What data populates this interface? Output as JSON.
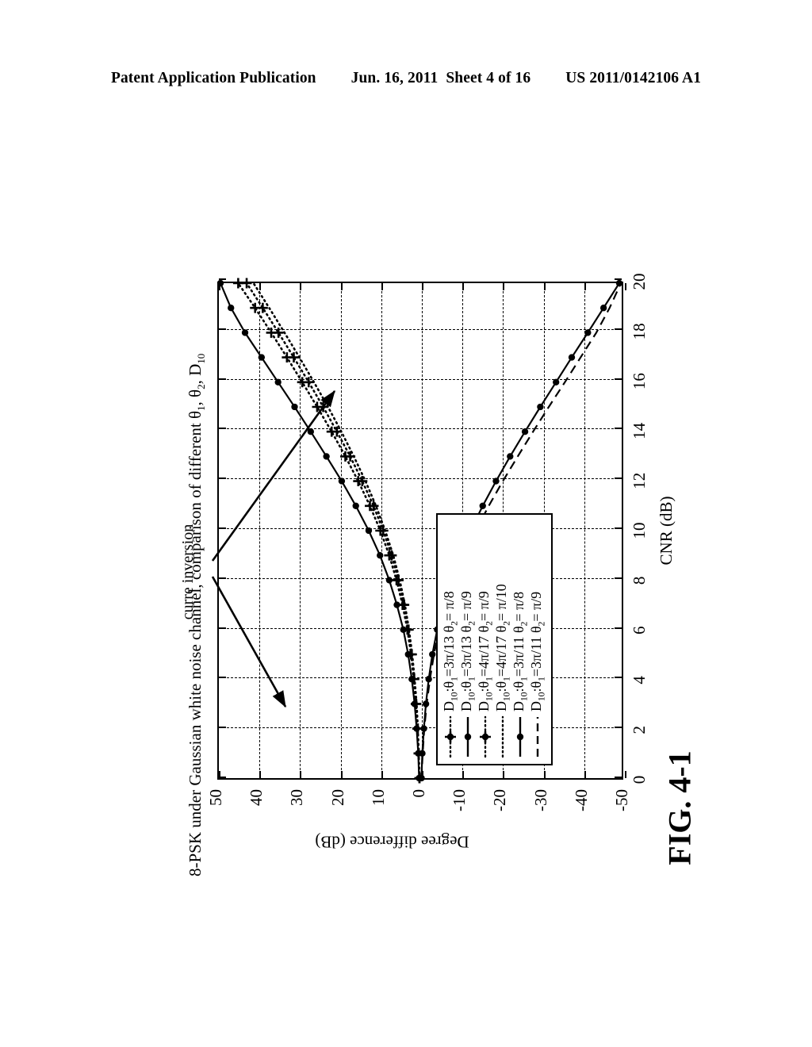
{
  "header": {
    "publication": "Patent Application Publication",
    "date": "Jun. 16, 2011",
    "sheet": "Sheet 4 of 16",
    "patent_number": "US 2011/0142106 A1"
  },
  "figure": {
    "caption": "FIG. 4-1"
  },
  "annotation": {
    "label": "curre inversion"
  },
  "legend": {
    "entries": [
      {
        "sample": "dotted-plus",
        "label": "D10:θ1=3π/13  θ2= π/8"
      },
      {
        "sample": "solid-dot",
        "label": "D10:θ1=3π/13  θ2= π/9"
      },
      {
        "sample": "dotted-plus",
        "label": "D10:θ1=4π/17  θ2= π/9"
      },
      {
        "sample": "dotted-line",
        "label": "D10:θ1=4π/17  θ2= π/10"
      },
      {
        "sample": "solid-dot",
        "label": "D10:θ1=3π/11  θ2= π/8"
      },
      {
        "sample": "dashed-line",
        "label": "D10:θ1=3π/11  θ2= π/9"
      }
    ]
  },
  "chart_data": {
    "type": "line",
    "title": "8-PSK under Gaussian white noise channel, comparison of different θ1, θ2, D10",
    "xlabel": "CNR (dB)",
    "ylabel": "Degree difference (dB)",
    "xlim": [
      0,
      20
    ],
    "ylim": [
      -50,
      50
    ],
    "xticks": [
      0,
      2,
      4,
      6,
      8,
      10,
      12,
      14,
      16,
      18,
      20
    ],
    "yticks": [
      50,
      40,
      30,
      20,
      10,
      0,
      -10,
      -20,
      -30,
      -40,
      -50
    ],
    "grid": true,
    "legend_position": "lower-left-inside",
    "x": [
      0,
      1,
      2,
      3,
      4,
      5,
      6,
      7,
      8,
      9,
      10,
      11,
      12,
      13,
      14,
      15,
      16,
      17,
      18,
      19,
      20
    ],
    "series": [
      {
        "name": "D10:θ1=3π/13  θ2= π/8",
        "style": "dotted",
        "marker": "plus",
        "values": [
          0.2,
          0.4,
          0.7,
          1.1,
          1.6,
          2.3,
          3.2,
          4.4,
          5.9,
          7.7,
          9.9,
          12.5,
          15.4,
          18.6,
          22.0,
          25.6,
          29.3,
          33.1,
          37.0,
          41.0,
          45.2
        ]
      },
      {
        "name": "D10:θ1=3π/13  θ2= π/9",
        "style": "solid",
        "marker": "dot",
        "values": [
          0.3,
          0.5,
          0.9,
          1.4,
          2.1,
          3.0,
          4.2,
          5.8,
          7.7,
          10.0,
          12.8,
          16.0,
          19.5,
          23.3,
          27.2,
          31.2,
          35.3,
          39.4,
          43.5,
          47.0,
          49.6
        ]
      },
      {
        "name": "D10:θ1=4π/17  θ2= π/9",
        "style": "dotted",
        "marker": "plus",
        "values": [
          0.2,
          0.4,
          0.6,
          1.0,
          1.5,
          2.1,
          2.9,
          4.0,
          5.4,
          7.1,
          9.2,
          11.6,
          14.4,
          17.4,
          20.7,
          24.1,
          27.7,
          31.4,
          35.2,
          39.1,
          43.1
        ]
      },
      {
        "name": "D10:θ1=4π/17  θ2= π/10",
        "style": "dotted",
        "marker": "none",
        "values": [
          0.2,
          0.4,
          0.6,
          0.9,
          1.4,
          2.0,
          2.8,
          3.8,
          5.1,
          6.7,
          8.7,
          11.0,
          13.6,
          16.5,
          19.6,
          22.9,
          26.4,
          30.0,
          33.7,
          37.5,
          41.4
        ]
      },
      {
        "name": "D10:θ1=3π/11  θ2= π/8",
        "style": "solid",
        "marker": "dot",
        "values": [
          -0.3,
          -0.5,
          -0.9,
          -1.4,
          -2.1,
          -3.0,
          -4.2,
          -5.7,
          -7.6,
          -9.9,
          -12.5,
          -15.5,
          -18.8,
          -22.3,
          -26.0,
          -29.8,
          -33.7,
          -37.6,
          -41.6,
          -45.5,
          -49.4
        ]
      },
      {
        "name": "D10:θ1=3π/11  θ2= π/9",
        "style": "dashed",
        "marker": "none",
        "values": [
          -0.3,
          -0.6,
          -1.0,
          -1.6,
          -2.4,
          -3.4,
          -4.7,
          -6.4,
          -8.5,
          -11.0,
          -13.8,
          -17.0,
          -20.5,
          -24.2,
          -28.0,
          -31.9,
          -35.9,
          -39.8,
          -43.7,
          -47.0,
          -49.8
        ]
      }
    ]
  }
}
